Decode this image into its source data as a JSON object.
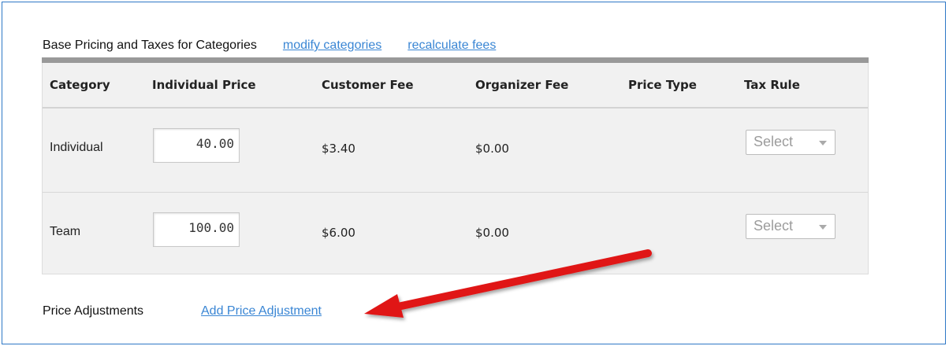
{
  "pricing": {
    "title": "Base Pricing and Taxes for Categories",
    "modify_link": "modify categories",
    "recalculate_link": "recalculate fees"
  },
  "table": {
    "headers": {
      "category": "Category",
      "individual_price": "Individual Price",
      "customer_fee": "Customer Fee",
      "organizer_fee": "Organizer Fee",
      "price_type": "Price Type",
      "tax_rule": "Tax Rule"
    },
    "rows": [
      {
        "category": "Individual",
        "price": "40.00",
        "customer_fee": "$3.40",
        "organizer_fee": "$0.00",
        "price_type": "",
        "tax_rule": "Select"
      },
      {
        "category": "Team",
        "price": "100.00",
        "customer_fee": "$6.00",
        "organizer_fee": "$0.00",
        "price_type": "",
        "tax_rule": "Select"
      }
    ]
  },
  "adjustments": {
    "label": "Price Adjustments",
    "add_link": "Add Price Adjustment"
  },
  "colors": {
    "link": "#3a86d4",
    "frame_border": "#2e78c6",
    "header_bar": "#999999",
    "grid_bg": "#f1f1f1",
    "arrow": "#e01818"
  },
  "icons": {
    "select_caret": "chevron-down-icon",
    "annotation": "red-arrow-icon"
  }
}
